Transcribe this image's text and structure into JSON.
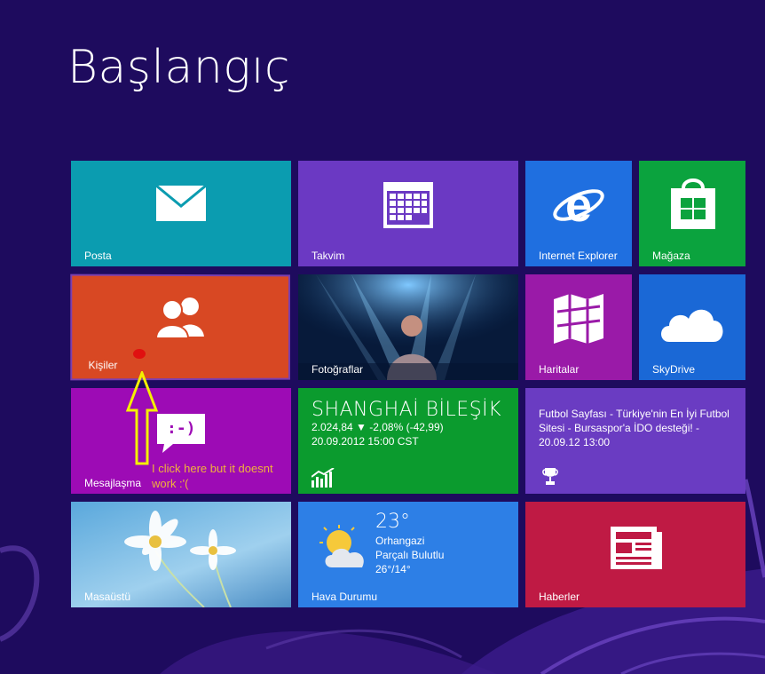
{
  "start_screen": {
    "title": "Başlangıç"
  },
  "tiles": {
    "posta": {
      "label": "Posta",
      "icon": "mail-icon"
    },
    "takvim": {
      "label": "Takvim",
      "icon": "calendar-icon"
    },
    "internet_explorer": {
      "label": "Internet Explorer",
      "icon": "ie-icon"
    },
    "magaza": {
      "label": "Mağaza",
      "icon": "store-icon"
    },
    "kisiler": {
      "label": "Kişiler",
      "icon": "people-icon"
    },
    "fotograflar": {
      "label": "Fotoğraflar"
    },
    "haritalar": {
      "label": "Haritalar",
      "icon": "maps-icon"
    },
    "skydrive": {
      "label": "SkyDrive",
      "icon": "cloud-icon"
    },
    "mesajlasma": {
      "label": "Mesajlaşma",
      "icon": "messaging-icon",
      "emoticon": ":-)"
    },
    "finans": {
      "title": "SHANGHAİ BİLEŞİK",
      "value_line": "2.024,84  ▼ -2,08% (-42,99)",
      "date_line": "20.09.2012 15:00 CST",
      "icon": "chart-icon"
    },
    "spor": {
      "headline": "Futbol Sayfası - Türkiye'nin En İyi Futbol Sitesi - Bursaspor'a İDO desteği! - 20.09.12 13:00",
      "icon": "trophy-icon"
    },
    "masaustu": {
      "label": "Masaüstü"
    },
    "hava_durumu": {
      "label": "Hava Durumu",
      "temperature": "23°",
      "city": "Orhangazi",
      "condition": "Parçalı Bulutlu",
      "range": "26°/14°",
      "icon": "weather-icon"
    },
    "haberler": {
      "label": "Haberler",
      "icon": "news-icon"
    }
  },
  "annotation": {
    "note_line1": "I click here but it doesnt",
    "note_line2": "work :'(",
    "color": "#f0b23c"
  }
}
